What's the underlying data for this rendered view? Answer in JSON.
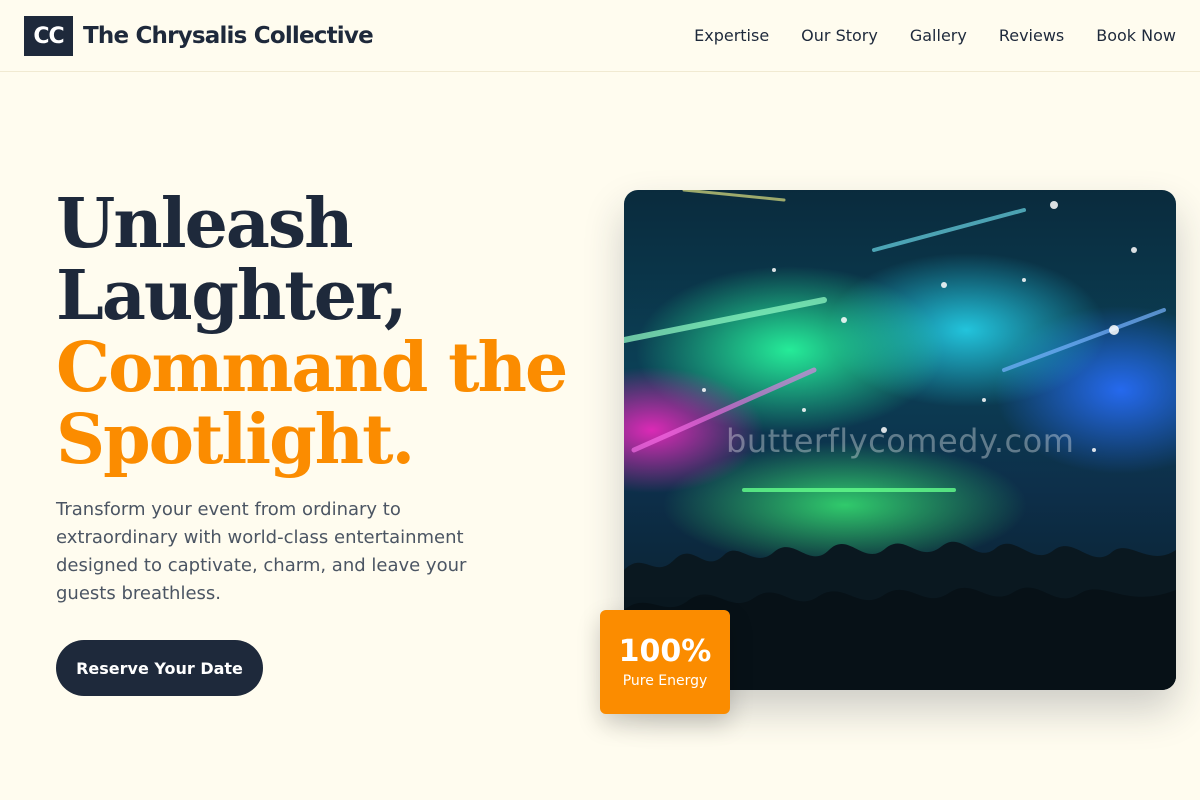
{
  "brand": {
    "logo_text": "CC",
    "name": "The Chrysalis Collective"
  },
  "nav": {
    "items": [
      "Expertise",
      "Our Story",
      "Gallery",
      "Reviews",
      "Book Now"
    ]
  },
  "hero": {
    "headline_dark": [
      "Unleash",
      "Laughter,"
    ],
    "headline_accent": [
      "Command the",
      "Spotlight."
    ],
    "lead": "Transform your event from ordinary to extraordinary with world-class entertainment designed to captivate, charm, and leave your guests breathless.",
    "cta_label": "Reserve Your Date"
  },
  "photo": {
    "watermark": "butterflycomedy.com"
  },
  "badge": {
    "value": "100%",
    "label": "Pure Energy"
  },
  "colors": {
    "accent": "#fb8c00",
    "dark": "#1e293b",
    "background": "#fffcef"
  }
}
